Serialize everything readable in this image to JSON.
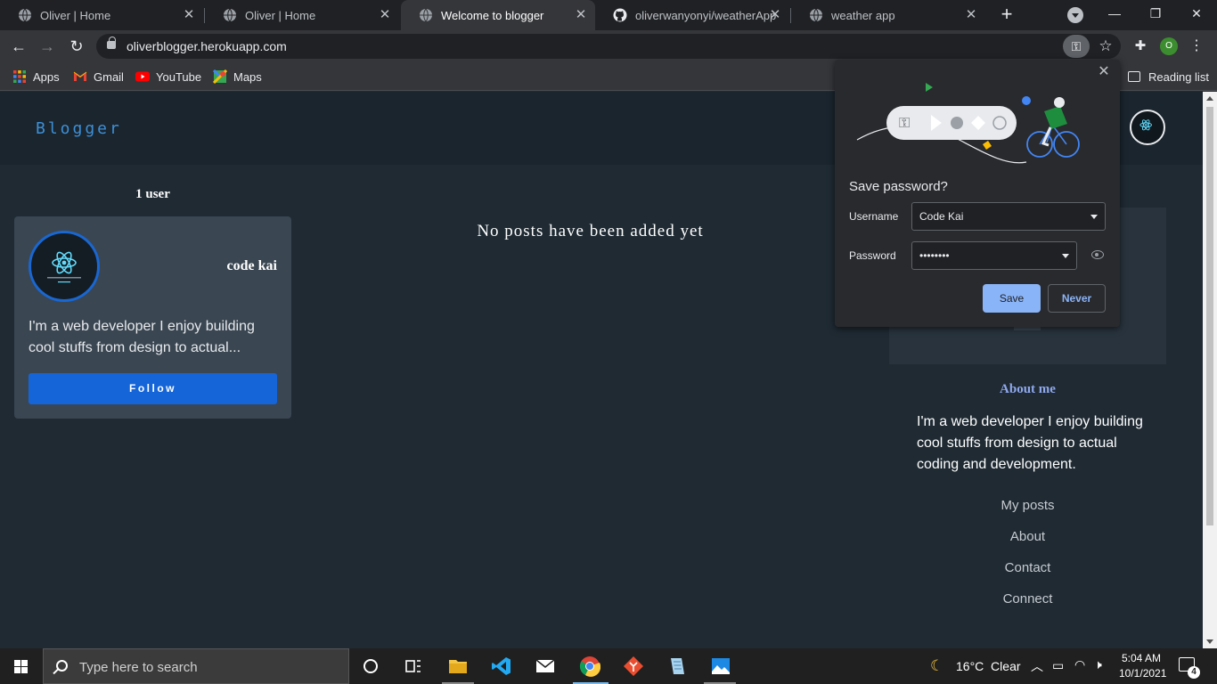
{
  "browser": {
    "tabs": [
      {
        "title": "Oliver | Home",
        "favicon": "globe-icon",
        "active": false
      },
      {
        "title": "Oliver | Home",
        "favicon": "globe-icon",
        "active": false
      },
      {
        "title": "Welcome to blogger",
        "favicon": "globe-icon",
        "active": true
      },
      {
        "title": "oliverwanyonyi/weatherApp",
        "favicon": "github-icon",
        "active": false
      },
      {
        "title": "weather app",
        "favicon": "globe-icon",
        "active": false
      }
    ],
    "url": "oliverblogger.herokuapp.com",
    "profile_initial": "O",
    "bookmarks": [
      {
        "label": "Apps",
        "icon": "apps-grid-icon"
      },
      {
        "label": "Gmail",
        "icon": "gmail-icon"
      },
      {
        "label": "YouTube",
        "icon": "youtube-icon"
      },
      {
        "label": "Maps",
        "icon": "maps-icon"
      }
    ],
    "reading_list": "Reading list"
  },
  "password_popup": {
    "title": "Save password?",
    "username_label": "Username",
    "username_value": "Code Kai",
    "password_label": "Password",
    "password_value": "••••••••",
    "save_label": "Save",
    "never_label": "Never"
  },
  "site": {
    "brand": "Blogger",
    "users_count": "1 user",
    "user_card": {
      "name": "code kai",
      "bio": "I'm a web developer I enjoy building cool stuffs from design to actual...",
      "follow_label": "Follow"
    },
    "empty_message": "No posts have been added yet",
    "sidebar": {
      "about_title": "About me",
      "about_text": "I'm a web developer I enjoy building cool stuffs from design to actual coding and development.",
      "links": [
        "My posts",
        "About",
        "Contact",
        "Connect"
      ]
    }
  },
  "taskbar": {
    "search_placeholder": "Type here to search",
    "weather": "16°C  Clear",
    "time": "5:04 AM",
    "date": "10/1/2021",
    "notifications": "4"
  },
  "colors": {
    "page_bg": "#1f2a33",
    "accent_blue": "#1565d8",
    "about_title": "#8fa8ee",
    "chrome_save": "#8ab4f8"
  }
}
